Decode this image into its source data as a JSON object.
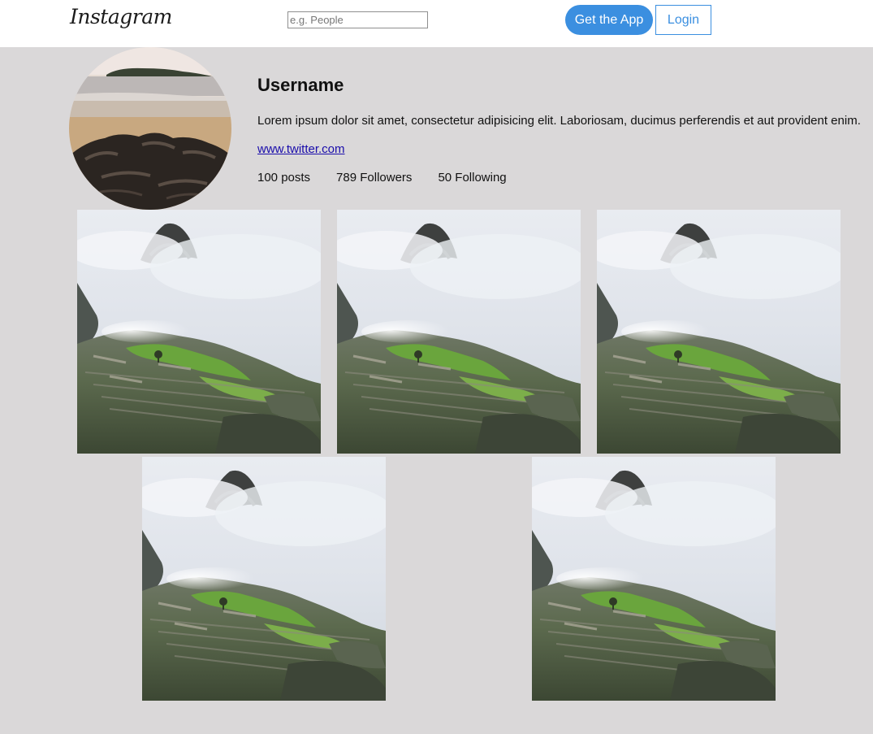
{
  "header": {
    "logo": "Instagram",
    "search_placeholder": "e.g. People",
    "get_app_label": "Get the App",
    "login_label": "Login"
  },
  "profile": {
    "avatar_icon": "beach-photo",
    "username": "Username",
    "bio": "Lorem ipsum dolor sit amet, consectetur adipisicing elit. Laboriosam, ducimus perferendis et aut provident enim.",
    "link": "www.twitter.com",
    "stats": {
      "posts": "100 posts",
      "followers": "789 Followers",
      "following": "50 Following"
    }
  },
  "posts": [
    {
      "image": "machu-picchu-photo"
    },
    {
      "image": "machu-picchu-photo"
    },
    {
      "image": "machu-picchu-photo"
    },
    {
      "image": "machu-picchu-photo"
    },
    {
      "image": "machu-picchu-photo"
    }
  ],
  "colors": {
    "accent": "#3b8fe0",
    "page_background": "#dad8d9",
    "link": "#1a0dab"
  }
}
